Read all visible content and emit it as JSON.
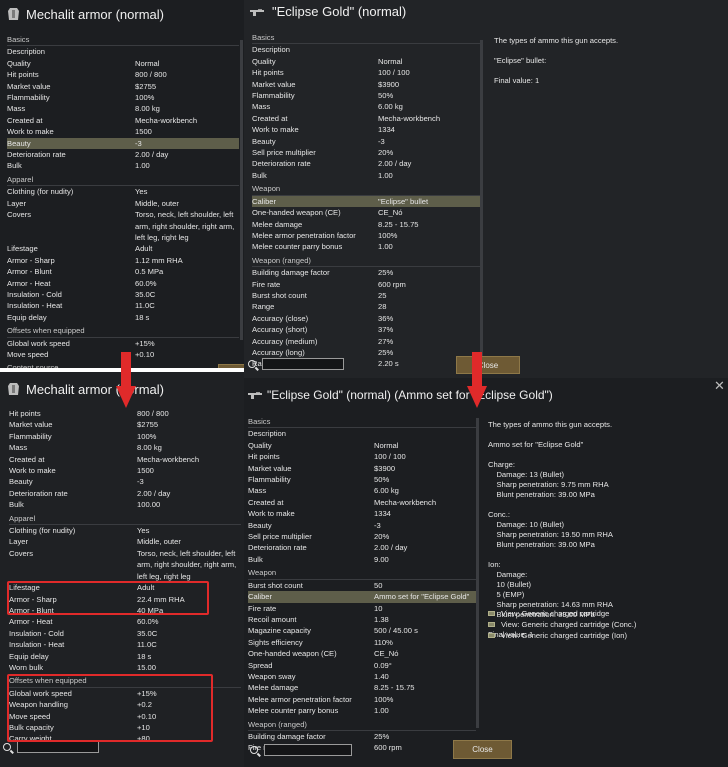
{
  "p1": {
    "title": "Mechalit armor (normal)",
    "rows": [
      {
        "k": "sec",
        "l": "Basics",
        "v": ""
      },
      {
        "k": "row",
        "l": "Description",
        "v": ""
      },
      {
        "k": "row",
        "l": "Quality",
        "v": "Normal"
      },
      {
        "k": "row",
        "l": "Hit points",
        "v": "800 / 800"
      },
      {
        "k": "row",
        "l": "Market value",
        "v": "$2755"
      },
      {
        "k": "row",
        "l": "Flammability",
        "v": "100%"
      },
      {
        "k": "row",
        "l": "Mass",
        "v": "8.00 kg"
      },
      {
        "k": "row",
        "l": "Created at",
        "v": "Mecha-workbench"
      },
      {
        "k": "row",
        "l": "Work to make",
        "v": "1500"
      },
      {
        "k": "hl",
        "l": "Beauty",
        "v": "-3"
      },
      {
        "k": "row",
        "l": "Deterioration rate",
        "v": "2.00 / day"
      },
      {
        "k": "row",
        "l": "Bulk",
        "v": "1.00"
      },
      {
        "k": "sec",
        "l": "Apparel",
        "v": ""
      },
      {
        "k": "row",
        "l": "Clothing (for nudity)",
        "v": "Yes"
      },
      {
        "k": "row",
        "l": "Layer",
        "v": "Middle, outer"
      },
      {
        "k": "row",
        "l": "Covers",
        "v": "Torso, neck, left shoulder, left\narm, right shoulder, right arm,\nleft leg, right leg"
      },
      {
        "k": "row",
        "l": "Lifestage",
        "v": "Adult"
      },
      {
        "k": "row",
        "l": "Armor - Sharp",
        "v": "1.12 mm RHA"
      },
      {
        "k": "row",
        "l": "Armor - Blunt",
        "v": "0.5 MPa"
      },
      {
        "k": "row",
        "l": "Armor - Heat",
        "v": "60.0%"
      },
      {
        "k": "row",
        "l": "Insulation - Cold",
        "v": "35.0C"
      },
      {
        "k": "row",
        "l": "Insulation - Heat",
        "v": "11.0C"
      },
      {
        "k": "row",
        "l": "Equip delay",
        "v": "18 s"
      },
      {
        "k": "sec",
        "l": "Offsets when equipped",
        "v": ""
      },
      {
        "k": "row",
        "l": "Global work speed",
        "v": "+15%"
      },
      {
        "k": "row",
        "l": "Move speed",
        "v": "+0.10"
      },
      {
        "k": "sec",
        "l": "Content source",
        "v": ""
      }
    ]
  },
  "p2": {
    "title": "\"Eclipse Gold\" (normal)",
    "rows": [
      {
        "k": "sec",
        "l": "Basics",
        "v": ""
      },
      {
        "k": "row",
        "l": "Description",
        "v": ""
      },
      {
        "k": "row",
        "l": "Quality",
        "v": "Normal"
      },
      {
        "k": "row",
        "l": "Hit points",
        "v": "100 / 100"
      },
      {
        "k": "row",
        "l": "Market value",
        "v": "$3900"
      },
      {
        "k": "row",
        "l": "Flammability",
        "v": "50%"
      },
      {
        "k": "row",
        "l": "Mass",
        "v": "6.00 kg"
      },
      {
        "k": "row",
        "l": "Created at",
        "v": "Mecha-workbench"
      },
      {
        "k": "row",
        "l": "Work to make",
        "v": "1334"
      },
      {
        "k": "row",
        "l": "Beauty",
        "v": "-3"
      },
      {
        "k": "row",
        "l": "Sell price multiplier",
        "v": "20%"
      },
      {
        "k": "row",
        "l": "Deterioration rate",
        "v": "2.00 / day"
      },
      {
        "k": "row",
        "l": "Bulk",
        "v": "1.00"
      },
      {
        "k": "sec",
        "l": "Weapon",
        "v": ""
      },
      {
        "k": "hl",
        "l": "Caliber",
        "v": "\"Eclipse\" bullet"
      },
      {
        "k": "row",
        "l": "One-handed weapon (CE)",
        "v": "CE_Nó"
      },
      {
        "k": "row",
        "l": "Melee damage",
        "v": "8.25 - 15.75"
      },
      {
        "k": "row",
        "l": "Melee armor penetration factor",
        "v": "100%"
      },
      {
        "k": "row",
        "l": "Melee counter parry bonus",
        "v": "1.00"
      },
      {
        "k": "sec",
        "l": "Weapon (ranged)",
        "v": ""
      },
      {
        "k": "row",
        "l": "Building damage factor",
        "v": "25%"
      },
      {
        "k": "row",
        "l": "Fire rate",
        "v": "600 rpm"
      },
      {
        "k": "row",
        "l": "Burst shot count",
        "v": "25"
      },
      {
        "k": "row",
        "l": "Range",
        "v": "28"
      },
      {
        "k": "row",
        "l": "Accuracy (close)",
        "v": "36%"
      },
      {
        "k": "row",
        "l": "Accuracy (short)",
        "v": "37%"
      },
      {
        "k": "row",
        "l": "Accuracy (medium)",
        "v": "27%"
      },
      {
        "k": "row",
        "l": "Accuracy (long)",
        "v": "25%"
      },
      {
        "k": "row",
        "l": "Ranged cooldown",
        "v": "2.20 s"
      }
    ],
    "desc": "The types of ammo this gun accepts.\n\n\"Eclipse\" bullet:\n\nFinal value: 1",
    "close": "Close"
  },
  "p3": {
    "title": "Mechalit armor (normal)",
    "rows": [
      {
        "k": "row",
        "l": "Hit points",
        "v": "800 / 800"
      },
      {
        "k": "row",
        "l": "Market value",
        "v": "$2755"
      },
      {
        "k": "row",
        "l": "Flammability",
        "v": "100%"
      },
      {
        "k": "row",
        "l": "Mass",
        "v": "8.00 kg"
      },
      {
        "k": "row",
        "l": "Created at",
        "v": "Mecha-workbench"
      },
      {
        "k": "row",
        "l": "Work to make",
        "v": "1500"
      },
      {
        "k": "row",
        "l": "Beauty",
        "v": "-3"
      },
      {
        "k": "row",
        "l": "Deterioration rate",
        "v": "2.00 / day"
      },
      {
        "k": "row",
        "l": "Bulk",
        "v": "100.00"
      },
      {
        "k": "sec",
        "l": "Apparel",
        "v": ""
      },
      {
        "k": "row",
        "l": "Clothing (for nudity)",
        "v": "Yes"
      },
      {
        "k": "row",
        "l": "Layer",
        "v": "Middle, outer"
      },
      {
        "k": "row",
        "l": "Covers",
        "v": "Torso, neck, left shoulder, left\narm, right shoulder, right arm,\nleft leg, right leg"
      },
      {
        "k": "row",
        "l": "Lifestage",
        "v": "Adult"
      },
      {
        "k": "row",
        "l": "Armor - Sharp",
        "v": "22.4 mm RHA"
      },
      {
        "k": "row",
        "l": "Armor - Blunt",
        "v": "40 MPa"
      },
      {
        "k": "row",
        "l": "Armor - Heat",
        "v": "60.0%"
      },
      {
        "k": "row",
        "l": "Insulation - Cold",
        "v": "35.0C"
      },
      {
        "k": "row",
        "l": "Insulation - Heat",
        "v": "11.0C"
      },
      {
        "k": "row",
        "l": "Equip delay",
        "v": "18 s"
      },
      {
        "k": "row",
        "l": "Worn bulk",
        "v": "15.00"
      },
      {
        "k": "sec",
        "l": "Offsets when equipped",
        "v": ""
      },
      {
        "k": "row",
        "l": "Global work speed",
        "v": "+15%"
      },
      {
        "k": "row",
        "l": "Weapon handling",
        "v": "+0.2"
      },
      {
        "k": "row",
        "l": "Move speed",
        "v": "+0.10"
      },
      {
        "k": "row",
        "l": "Bulk capacity",
        "v": "+10"
      },
      {
        "k": "row",
        "l": "Carry weight",
        "v": "+80"
      }
    ]
  },
  "p4": {
    "title": "\"Eclipse Gold\" (normal) (Ammo set for \"Eclipse Gold\")",
    "rows": [
      {
        "k": "sec",
        "l": "Basics",
        "v": ""
      },
      {
        "k": "row",
        "l": "Description",
        "v": ""
      },
      {
        "k": "row",
        "l": "Quality",
        "v": "Normal"
      },
      {
        "k": "row",
        "l": "Hit points",
        "v": "100 / 100"
      },
      {
        "k": "row",
        "l": "Market value",
        "v": "$3900"
      },
      {
        "k": "row",
        "l": "Flammability",
        "v": "50%"
      },
      {
        "k": "row",
        "l": "Mass",
        "v": "6.00 kg"
      },
      {
        "k": "row",
        "l": "Created at",
        "v": "Mecha-workbench"
      },
      {
        "k": "row",
        "l": "Work to make",
        "v": "1334"
      },
      {
        "k": "row",
        "l": "Beauty",
        "v": "-3"
      },
      {
        "k": "row",
        "l": "Sell price multiplier",
        "v": "20%"
      },
      {
        "k": "row",
        "l": "Deterioration rate",
        "v": "2.00 / day"
      },
      {
        "k": "row",
        "l": "Bulk",
        "v": "9.00"
      },
      {
        "k": "sec",
        "l": "Weapon",
        "v": ""
      },
      {
        "k": "row",
        "l": "Burst shot count",
        "v": "50"
      },
      {
        "k": "hl",
        "l": "Caliber",
        "v": "Ammo set for \"Eclipse Gold\""
      },
      {
        "k": "row",
        "l": "Fire rate",
        "v": "10"
      },
      {
        "k": "row",
        "l": "Recoil amount",
        "v": "1.38"
      },
      {
        "k": "row",
        "l": "Magazine capacity",
        "v": "500 / 45.00 s"
      },
      {
        "k": "row",
        "l": "Sights efficiency",
        "v": "110%"
      },
      {
        "k": "row",
        "l": "One-handed weapon (CE)",
        "v": "CE_Nó"
      },
      {
        "k": "row",
        "l": "Spread",
        "v": "0.09°"
      },
      {
        "k": "row",
        "l": "Weapon sway",
        "v": "1.40"
      },
      {
        "k": "row",
        "l": "Melee damage",
        "v": "8.25 - 15.75"
      },
      {
        "k": "row",
        "l": "Melee armor penetration factor",
        "v": "100%"
      },
      {
        "k": "row",
        "l": "Melee counter parry bonus",
        "v": "1.00"
      },
      {
        "k": "sec",
        "l": "Weapon (ranged)",
        "v": ""
      },
      {
        "k": "row",
        "l": "Building damage factor",
        "v": "25%"
      },
      {
        "k": "row",
        "l": "Fire rate",
        "v": "600 rpm"
      }
    ],
    "desc": "The types of ammo this gun accepts.\n\nAmmo set for \"Eclipse Gold\"\n\nCharge:\n    Damage: 13 (Bullet)\n    Sharp penetration: 9.75 mm RHA\n    Blunt penetration: 39.00 MPa\n\nConc.:\n    Damage: 10 (Bullet)\n    Sharp penetration: 19.50 mm RHA\n    Blunt penetration: 39.00 MPa\n\nIon:\n    Damage:\n    10 (Bullet)\n    5 (EMP)\n    Sharp penetration: 14.63 mm RHA\n    Blunt penetration: 39.00 MPa\n\nFinal value: 1",
    "links": [
      "View: Generic charged cartridge",
      "View: Generic charged cartridge (Conc.)",
      "View: Generic charged cartridge (Ion)"
    ],
    "close": "Close"
  }
}
